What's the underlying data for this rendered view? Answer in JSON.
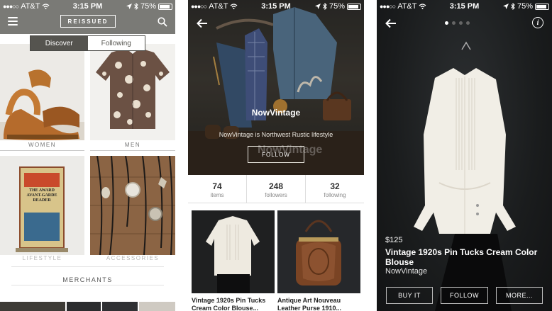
{
  "status_bar": {
    "carrier": "AT&T",
    "time": "3:15 PM",
    "battery": "75%"
  },
  "discover_screen": {
    "logo_text": "REISSUED",
    "tabs": [
      {
        "label": "Discover",
        "active": true
      },
      {
        "label": "Following",
        "active": false
      }
    ],
    "categories": [
      {
        "label": "WOMEN"
      },
      {
        "label": "MEN"
      },
      {
        "label": "LIFESTYLE"
      },
      {
        "label": "ACCESSORIES"
      }
    ],
    "book_text": "THE AWARD AVANT-GARDE READER",
    "section_heading": "MERCHANTS"
  },
  "shop_screen": {
    "shop_name": "NowVintage",
    "tagline": "NowVintage is Northwest Rustic lifestyle",
    "follow_label": "FOLLOW",
    "watermark": "NowVintage",
    "stats": [
      {
        "number": "74",
        "label": "items"
      },
      {
        "number": "248",
        "label": "followers"
      },
      {
        "number": "32",
        "label": "following"
      }
    ],
    "products": [
      {
        "title": "Vintage 1920s Pin Tucks Cream Color Blouse..."
      },
      {
        "title": "Antique Art Nouveau Leather Purse 1910..."
      }
    ]
  },
  "product_screen": {
    "pager": {
      "count": 4,
      "active_index": 0
    },
    "info_icon_text": "i",
    "price": "$125",
    "title": "Vintage 1920s Pin Tucks Cream Color Blouse",
    "shop": "NowVintage",
    "buttons": [
      {
        "label": "BUY IT"
      },
      {
        "label": "FOLLOW"
      },
      {
        "label": "MORE..."
      }
    ]
  },
  "colors": {
    "topbar_gray": "#7a7a76",
    "segment_active": "#55544f",
    "product_bg": "#151617"
  }
}
